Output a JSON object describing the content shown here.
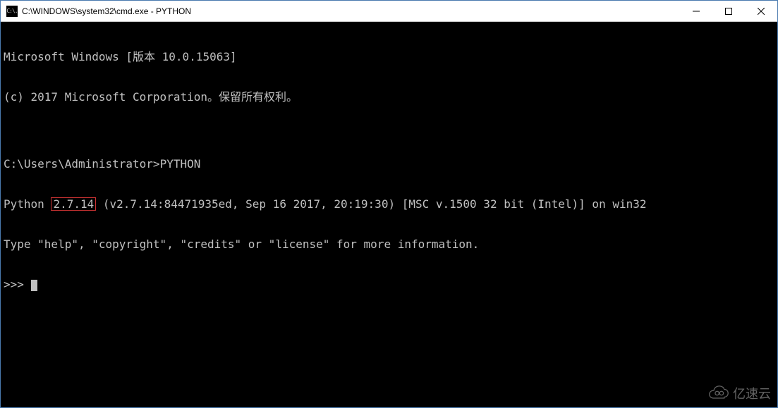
{
  "titlebar": {
    "icon_text": "C:\\.",
    "title": "C:\\WINDOWS\\system32\\cmd.exe - PYTHON"
  },
  "terminal": {
    "line1": "Microsoft Windows [版本 10.0.15063]",
    "line2": "(c) 2017 Microsoft Corporation。保留所有权利。",
    "line3": "",
    "line4_prefix": "C:\\Users\\Administrator>",
    "line4_cmd": "PYTHON",
    "line5_prefix": "Python ",
    "line5_version": "2.7.14",
    "line5_rest": " (v2.7.14:84471935ed, Sep 16 2017, 20:19:30) [MSC v.1500 32 bit (Intel)] on win32",
    "line6": "Type \"help\", \"copyright\", \"credits\" or \"license\" for more information.",
    "line7_prompt": ">>> "
  },
  "watermark": {
    "text": "亿速云"
  }
}
